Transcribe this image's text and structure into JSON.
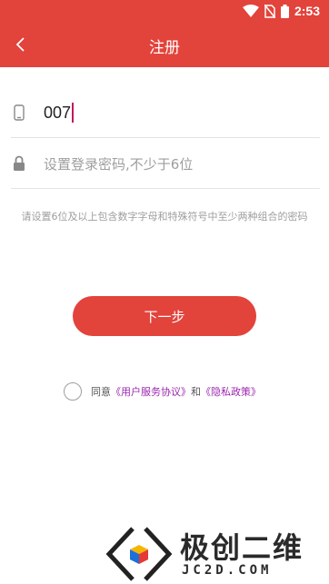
{
  "status_bar": {
    "time": "2:53"
  },
  "header": {
    "title": "注册"
  },
  "form": {
    "phone_value": "007",
    "password_placeholder": "设置登录密码,不少于6位",
    "hint": "请设置6位及以上包含数字字母和特殊符号中至少两种组合的密码"
  },
  "next_button": {
    "label": "下一步"
  },
  "agreement": {
    "prefix": "同意",
    "user_agreement": "《用户服务协议》",
    "and": "和",
    "privacy_policy": "《隐私政策》"
  },
  "watermark": {
    "cn": "极创二维",
    "en": "JC2D.COM"
  },
  "colors": {
    "accent": "#e2433b",
    "link": "#9c27b0",
    "caret": "#c2185b"
  }
}
